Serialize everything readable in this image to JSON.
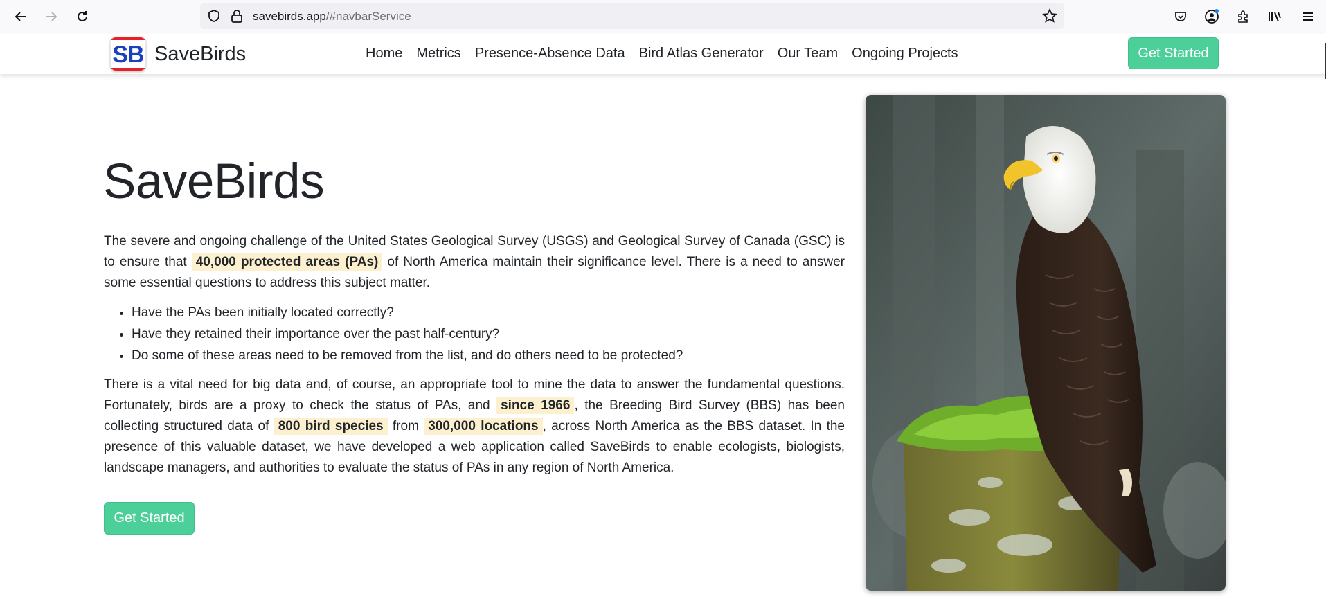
{
  "browser": {
    "url_host": "savebirds.app",
    "url_path": "/#navbarService"
  },
  "navbar": {
    "brand_logo_text": "SB",
    "brand_name": "SaveBirds",
    "items": [
      "Home",
      "Metrics",
      "Presence-Absence Data",
      "Bird Atlas Generator",
      "Our Team",
      "Ongoing Projects"
    ],
    "cta_label": "Get Started"
  },
  "hero": {
    "title": "SaveBirds",
    "p1_a": "The severe and ongoing challenge of the United States Geological Survey (USGS) and Geological Survey of Canada (GSC) is to ensure that ",
    "p1_hl": "40,000 protected areas (PAs)",
    "p1_b": " of North America maintain their significance level. There is a need to answer some essential questions to address this subject matter.",
    "questions": [
      "Have the PAs been initially located correctly?",
      "Have they retained their importance over the past half-century?",
      "Do some of these areas need to be removed from the list, and do others need to be protected?"
    ],
    "p2_a": "There is a vital need for big data and, of course, an appropriate tool to mine the data to answer the fundamental questions. Fortunately, birds are a proxy to check the status of PAs, and ",
    "p2_hl1": "since 1966",
    "p2_b": ", the Breeding Bird Survey (BBS) has been collecting structured data of ",
    "p2_hl2": "800 bird species",
    "p2_c": " from ",
    "p2_hl3": "300,000 locations",
    "p2_d": ", across North America as the BBS dataset. In the presence of this valuable dataset, we have developed a web application called SaveBirds to enable ecologists, biologists, landscape managers, and authorities to evaluate the status of PAs in any region of North America.",
    "cta_label": "Get Started"
  },
  "image": {
    "subject": "bald-eagle-photo"
  },
  "colors": {
    "accent": "#4ccf99",
    "highlight": "#fdf0cf",
    "logo_blue": "#1a3fbf",
    "logo_red": "#e8202a"
  }
}
